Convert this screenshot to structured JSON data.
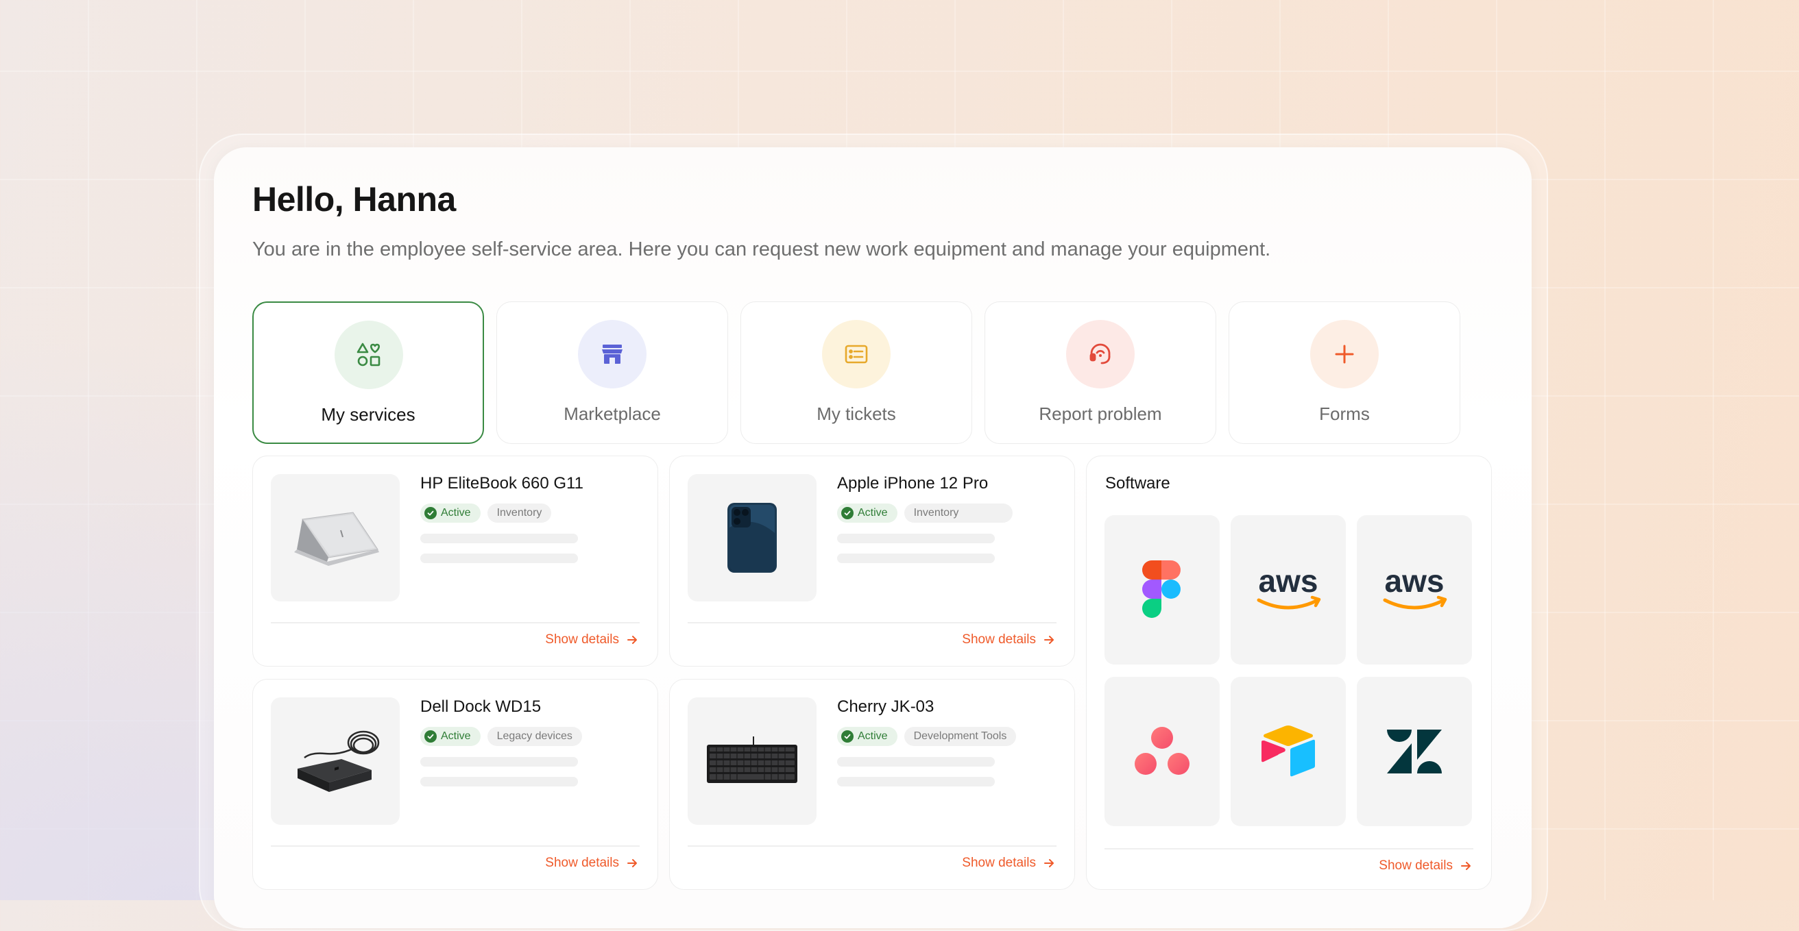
{
  "header": {
    "greeting": "Hello, Hanna",
    "subtitle": "You are in the employee self-service area. Here you can request new work equipment and manage your equipment."
  },
  "nav_tiles": [
    {
      "label": "My services",
      "icon": "shapes-icon",
      "active": true,
      "color": "#3a8a43"
    },
    {
      "label": "Marketplace",
      "icon": "store-icon",
      "active": false,
      "color": "#5b62d6"
    },
    {
      "label": "My tickets",
      "icon": "ticket-list-icon",
      "active": false,
      "color": "#e7a92b"
    },
    {
      "label": "Report problem",
      "icon": "headset-icon",
      "active": false,
      "color": "#e24a3b"
    },
    {
      "label": "Forms",
      "icon": "plus-icon",
      "active": false,
      "color": "#ef5a2a"
    }
  ],
  "devices": [
    {
      "name": "HP EliteBook 660 G11",
      "status": "Active",
      "tag": "Inventory",
      "image": "laptop-image",
      "action": "Show details"
    },
    {
      "name": "Apple iPhone 12 Pro",
      "status": "Active",
      "tag": "Inventory",
      "image": "phone-image",
      "action": "Show details"
    },
    {
      "name": "Dell Dock WD15",
      "status": "Active",
      "tag": "Legacy devices",
      "image": "dock-image",
      "action": "Show details"
    },
    {
      "name": "Cherry JK-03",
      "status": "Active",
      "tag": "Development Tools",
      "image": "keyboard-image",
      "action": "Show details"
    }
  ],
  "software": {
    "title": "Software",
    "apps": [
      "figma-logo",
      "aws-logo",
      "aws-logo",
      "asana-logo",
      "airtable-logo",
      "zendesk-logo"
    ],
    "aws_text": "aws",
    "action": "Show details"
  },
  "colors": {
    "accent": "#ef5a2a",
    "active_border": "#3a8a43",
    "status_green": "#2f7d36"
  }
}
